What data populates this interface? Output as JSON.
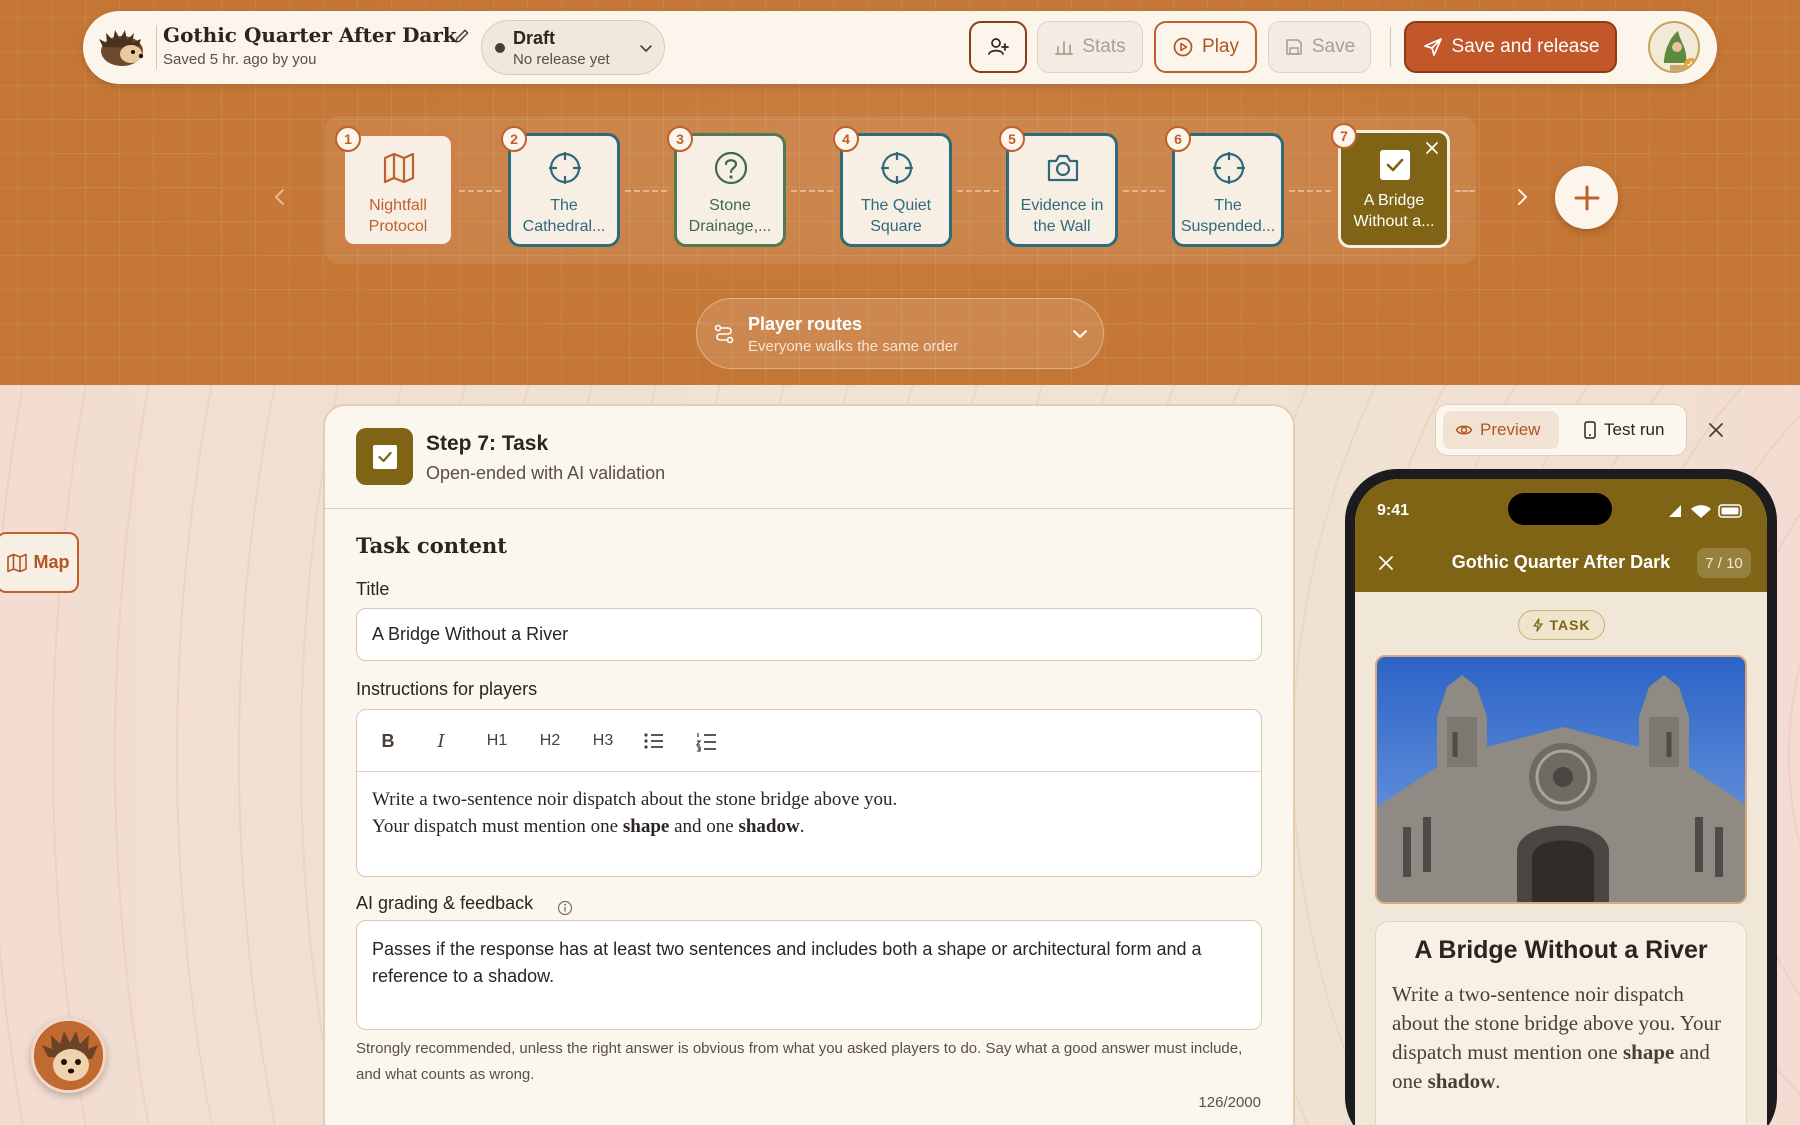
{
  "header": {
    "project_title": "Gothic Quarter After Dark",
    "saved_text": "Saved 5 hr. ago by you",
    "draft": {
      "label": "Draft",
      "sub": "No release yet"
    },
    "buttons": {
      "stats": "Stats",
      "play": "Play",
      "save": "Save",
      "release": "Save and release"
    }
  },
  "steps": [
    {
      "num": "1",
      "label": "Nightfall Protocol",
      "icon": "map-icon",
      "color": "orange"
    },
    {
      "num": "2",
      "label": "The Cathedral...",
      "icon": "crosshair-icon",
      "color": "teal"
    },
    {
      "num": "3",
      "label": "Stone Drainage,...",
      "icon": "question-icon",
      "color": "green"
    },
    {
      "num": "4",
      "label": "The Quiet Square",
      "icon": "crosshair-icon",
      "color": "teal"
    },
    {
      "num": "5",
      "label": "Evidence in the Wall",
      "icon": "camera-icon",
      "color": "teal"
    },
    {
      "num": "6",
      "label": "The Suspended...",
      "icon": "crosshair-icon",
      "color": "teal"
    },
    {
      "num": "7",
      "label": "A Bridge Without a...",
      "icon": "checkbox-icon",
      "color": "active"
    }
  ],
  "routes": {
    "title": "Player routes",
    "sub": "Everyone walks the same order"
  },
  "map_tab": "Map",
  "editor": {
    "heading": "Step 7: Task",
    "sub": "Open-ended with AI validation",
    "section_title": "Task content",
    "title_label": "Title",
    "title_value": "A Bridge Without a River",
    "instructions_label": "Instructions for players",
    "toolbar": {
      "bold": "B",
      "italic": "I",
      "h1": "H1",
      "h2": "H2",
      "h3": "H3"
    },
    "instructions_line1": "Write a two-sentence noir dispatch about the stone bridge above you.",
    "instructions_line2_a": "Your dispatch must mention one ",
    "instructions_line2_b": "shape",
    "instructions_line2_c": " and one ",
    "instructions_line2_d": "shadow",
    "instructions_line2_e": ".",
    "grading_label": "AI grading & feedback",
    "grading_value": "Passes if the response has at least two sentences and includes both a shape or architectural form and a reference to a shadow.",
    "hint": "Strongly recommended, unless the right answer is obvious from what you asked players to do. Say what a good answer must include, and what counts as wrong.",
    "counter": "126/2000"
  },
  "preview": {
    "tab_preview": "Preview",
    "tab_test": "Test run",
    "phone": {
      "time": "9:41",
      "title": "Gothic Quarter After Dark",
      "count": "7 / 10",
      "chip": "TASK",
      "card_title": "A Bridge Without a River",
      "body_a": "Write a two-sentence noir dispatch about the stone bridge above you. Your dispatch must mention one ",
      "body_b": "shape",
      "body_c": " and one ",
      "body_d": "shadow",
      "body_e": "."
    }
  },
  "colors": {
    "accent": "#c2572a",
    "band": "#c47634",
    "task": "#7e6414",
    "teal": "#2f6a7c"
  }
}
